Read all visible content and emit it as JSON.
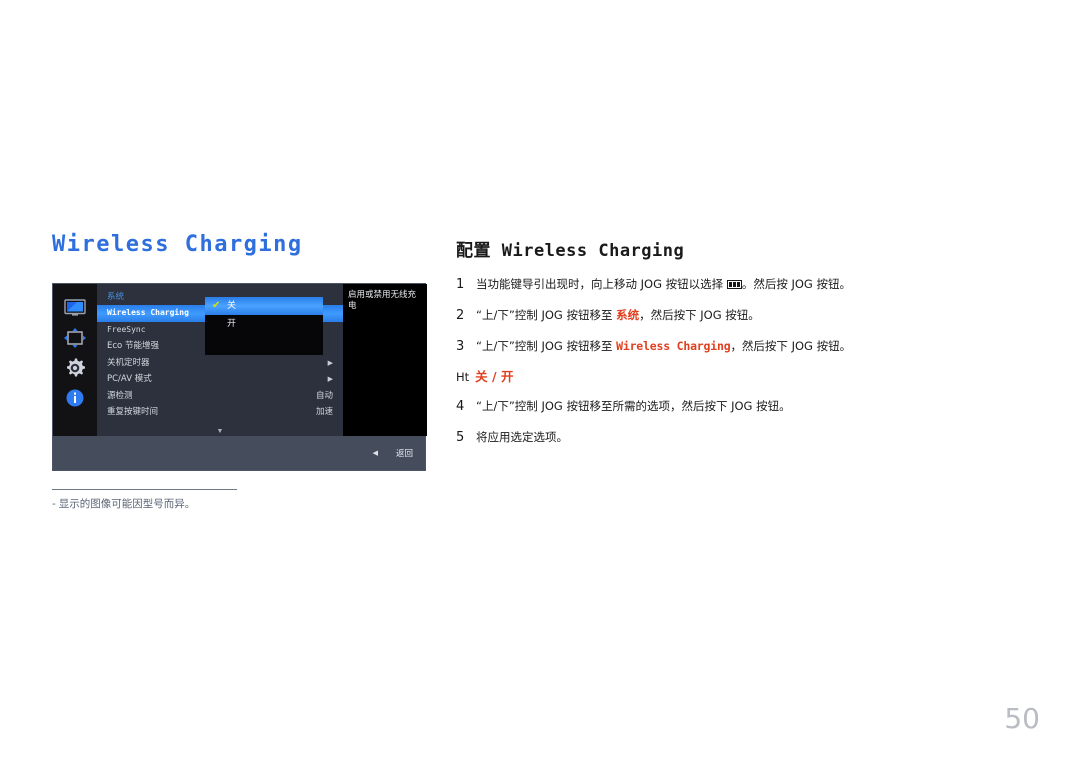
{
  "page": {
    "title": "Wireless Charging",
    "number": "50"
  },
  "osd": {
    "section_title": "系统",
    "sidebar_icons": [
      {
        "name": "picture-icon",
        "label": "图片"
      },
      {
        "name": "screen-adjust-icon",
        "label": "屏幕调整"
      },
      {
        "name": "gear-icon",
        "label": "系统"
      },
      {
        "name": "info-icon",
        "label": "信息"
      }
    ],
    "menu_items": [
      {
        "label": "Wireless Charging",
        "value": "",
        "arrow": false,
        "selected": true,
        "cjk": false
      },
      {
        "label": "FreeSync",
        "value": "",
        "arrow": false,
        "selected": false,
        "cjk": false
      },
      {
        "label": "Eco 节能增强",
        "value": "",
        "arrow": false,
        "selected": false,
        "cjk": true
      },
      {
        "label": "关机定时器",
        "value": "",
        "arrow": true,
        "selected": false,
        "cjk": true
      },
      {
        "label": "PC/AV 模式",
        "value": "",
        "arrow": true,
        "selected": false,
        "cjk": true
      },
      {
        "label": "源检测",
        "value": "自动",
        "arrow": false,
        "selected": false,
        "cjk": true
      },
      {
        "label": "重复按键时间",
        "value": "加速",
        "arrow": false,
        "selected": false,
        "cjk": true
      }
    ],
    "scroll_down_glyph": "▼",
    "submenu": [
      {
        "label": "关",
        "selected": true,
        "check": "✔"
      },
      {
        "label": "开",
        "selected": false,
        "check": ""
      }
    ],
    "description": "启用或禁用无线充电",
    "back_arrow": "◀",
    "back_label": "返回"
  },
  "note": {
    "bullet": "‑",
    "text": "显示的图像可能因型号而异。"
  },
  "instructions": {
    "heading": "配置 Wireless Charging",
    "steps": [
      {
        "num": "1",
        "pre": "当功能键导引出现时，向上移动 JOG 按钮以选择 ",
        "glyph": "menu-icon",
        "post": "。然后按 JOG 按钮。"
      },
      {
        "num": "2",
        "pre": "“上/下”控制 JOG 按钮移至 ",
        "highlight": "系统",
        "post": "，然后按下 JOG 按钮。"
      },
      {
        "num": "3",
        "pre": "“上/下”控制 JOG 按钮移至 ",
        "highlight": "Wireless Charging",
        "post": "，然后按下 JOG 按钮。"
      },
      {
        "num": "4",
        "pre": "“上/下”控制 JOG 按钮移至所需的选项，然后按下 JOG 按钮。",
        "highlight": "",
        "post": ""
      },
      {
        "num": "5",
        "pre": "将应用选定选项。",
        "highlight": "",
        "post": ""
      }
    ],
    "option_prefix": "Ht",
    "option_values": "关 / 开"
  }
}
